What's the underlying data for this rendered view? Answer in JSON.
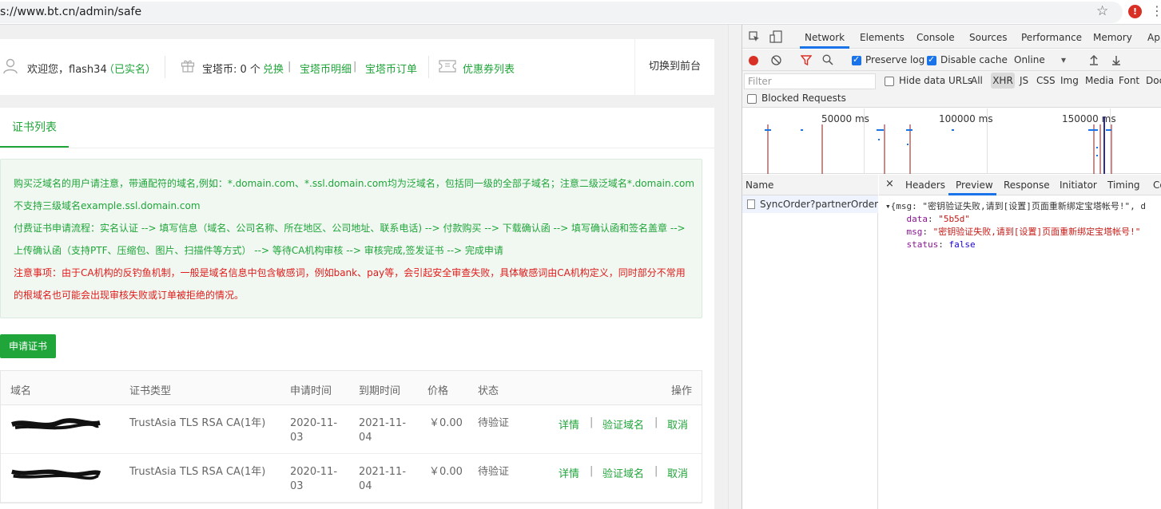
{
  "browser": {
    "url": "s://www.bt.cn/admin/safe",
    "extension_badge": "!"
  },
  "userbar": {
    "welcome": "欢迎您，flash34",
    "verified": "（已实名）",
    "coins_label": "宝塔币: 0 个",
    "exchange": "兑换",
    "sep1": "|",
    "coin_detail": "宝塔币明细",
    "sep2": "|",
    "coin_orders": "宝塔币订单",
    "coupons": "优惠券列表",
    "switch_front": "切换到前台"
  },
  "tabs": [
    "证书列表"
  ],
  "notice": {
    "line1": "购买泛域名的用户请注意，带通配符的域名,例如：*.domain.com、*.ssl.domain.com均为泛域名，包括同一级的全部子域名；注意二级泛域名*.domain.com",
    "line2": "不支持三级域名example.ssl.domain.com",
    "line3": "付费证书申请流程：实名认证 --> 填写信息（域名、公司名称、所在地区、公司地址、联系电话) --> 付款购买 --> 下载确认函 --> 填写确认函和签名盖章 -->",
    "line4": "上传确认函（支持PTF、压缩包、图片、扫描件等方式） --> 等待CA机构审核 --> 审核完成,签发证书 --> 完成申请",
    "line5": "注意事项：由于CA机构的反钓鱼机制，一般是域名信息中包含敏感词，例如bank、pay等，会引起安全审查失败，具体敏感词由CA机构定义，同时部分不常用",
    "line6": "的根域名也可能会出现审核失败或订单被拒绝的情况。"
  },
  "apply_button": "申请证书",
  "table": {
    "headers": {
      "domain": "域名",
      "type": "证书类型",
      "apply_time": "申请时间",
      "expire_time": "到期时间",
      "price": "价格",
      "status": "状态",
      "actions": "操作"
    },
    "rows": [
      {
        "type": "TrustAsia TLS RSA CA(1年)",
        "apply_1": "2020-11-",
        "apply_2": "03",
        "expire_1": "2021-11-",
        "expire_2": "04",
        "price": "￥0.00",
        "status": "待验证",
        "detail": "详情",
        "verify": "验证域名",
        "cancel": "取消",
        "sep": "|"
      },
      {
        "type": "TrustAsia TLS RSA CA(1年)",
        "apply_1": "2020-11-",
        "apply_2": "03",
        "expire_1": "2021-11-",
        "expire_2": "04",
        "price": "￥0.00",
        "status": "待验证",
        "detail": "详情",
        "verify": "验证域名",
        "cancel": "取消",
        "sep": "|"
      }
    ]
  },
  "devtools": {
    "tabs": [
      "Network",
      "Elements",
      "Console",
      "Sources",
      "Performance",
      "Memory",
      "App"
    ],
    "active_tab": "Network",
    "toolbar": {
      "preserve_log": "Preserve log",
      "disable_cache": "Disable cache",
      "throttle": "Online"
    },
    "filter": {
      "placeholder": "Filter",
      "hide_data_urls": "Hide data URLs",
      "types": [
        "All",
        "XHR",
        "JS",
        "CSS",
        "Img",
        "Media",
        "Font",
        "Doc"
      ],
      "active_type": "XHR",
      "blocked_requests": "Blocked Requests"
    },
    "timeline_labels": [
      "50000 ms",
      "100000 ms",
      "150000 ms"
    ],
    "name_header": "Name",
    "request_name": "SyncOrder?partnerOrderI...",
    "detail_tabs": [
      "Headers",
      "Preview",
      "Response",
      "Initiator",
      "Timing",
      "Co"
    ],
    "active_detail_tab": "Preview",
    "preview": {
      "summary": "{msg: \"密钥验证失败,请到[设置]页面重新绑定宝塔帐号!\", d",
      "data_key": "data",
      "data_value": "\"5b5d\"",
      "msg_key": "msg",
      "msg_value": "\"密钥验证失败,请到[设置]页面重新绑定宝塔帐号!\"",
      "status_key": "status",
      "status_value": "false"
    }
  },
  "colors": {
    "brand_green": "#20a53a",
    "warning_red": "#e01b1b",
    "devtools_blue": "#1a73e8"
  }
}
